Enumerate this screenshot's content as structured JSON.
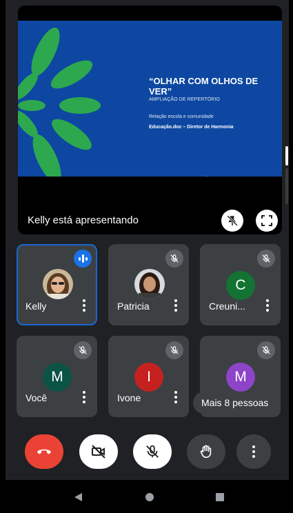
{
  "presentation": {
    "slide_title": "“OLHAR COM OLHOS DE VER”",
    "slide_subtitle": "AMPLIAÇÃO DE REPERTÓRIO",
    "slide_line1": "Relação escola e comunidade",
    "slide_line2": "Educação.doc – Diretor de Harmonia",
    "presenter_label": "Kelly está apresentando",
    "unpin_icon": "pin-off-icon",
    "fullscreen_icon": "fullscreen-icon"
  },
  "participants": [
    {
      "name": "Kelly",
      "status": "speaking",
      "avatar": "photo"
    },
    {
      "name": "Patricia",
      "status": "muted",
      "avatar": "photo"
    },
    {
      "name": "Creuni...",
      "status": "muted",
      "avatar": "letter",
      "initial": "C",
      "color": "#137333"
    },
    {
      "name": "Você",
      "status": "muted",
      "avatar": "letter",
      "initial": "M",
      "color": "#0b5345"
    },
    {
      "name": "Ivone",
      "status": "muted",
      "avatar": "letter",
      "initial": "I",
      "color": "#c5221f"
    },
    {
      "name": "",
      "status": "muted",
      "avatar": "letter",
      "initial": "M",
      "color": "#8e44c9"
    }
  ],
  "more_people": "Mais 8 pessoas",
  "controls": {
    "end_call_icon": "hang-up-icon",
    "camera_icon": "camera-off-icon",
    "mic_icon": "mic-off-icon",
    "hand_icon": "raise-hand-icon",
    "more_icon": "more-vert-icon",
    "end_call_color": "#ea4335"
  },
  "navbar": {
    "back": "back-icon",
    "home": "home-icon",
    "recents": "recents-icon"
  }
}
